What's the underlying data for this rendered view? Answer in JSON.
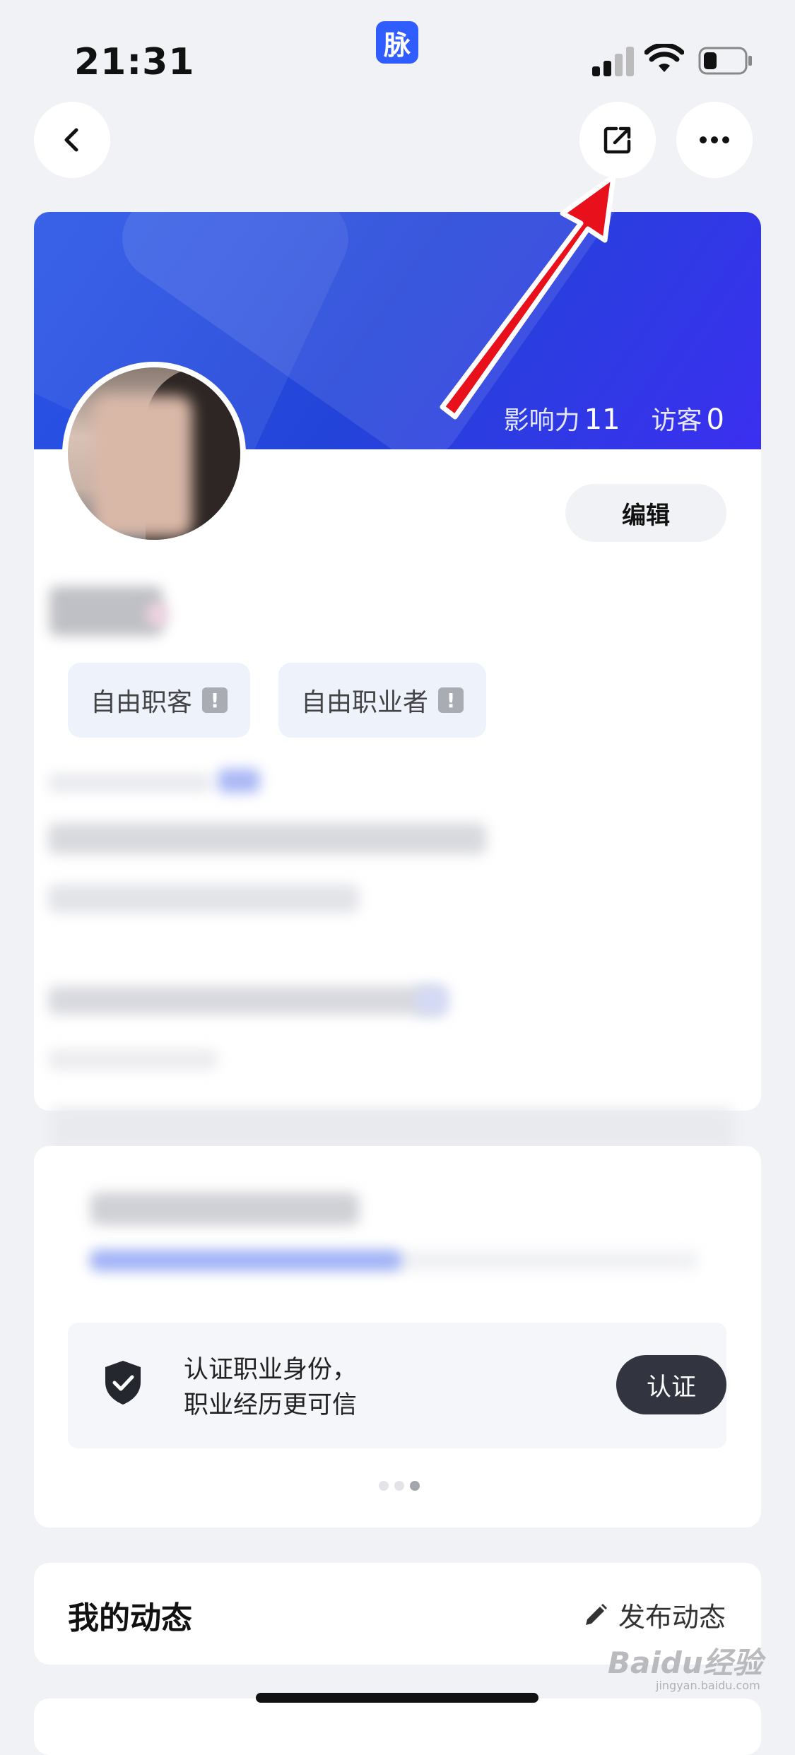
{
  "status_bar": {
    "time": "21:31",
    "app_badge": "脉",
    "accent": "#2f5dff"
  },
  "nav": {
    "back_icon": "chevron-left-icon",
    "share_icon": "share-external-icon",
    "more_icon": "more-horizontal-icon"
  },
  "profile": {
    "stats": [
      {
        "label": "影响力",
        "value": "11"
      },
      {
        "label": "访客",
        "value": "0"
      }
    ],
    "edit_label": "编辑",
    "tags": [
      {
        "label": "自由职客",
        "badge": "!"
      },
      {
        "label": "自由职业者",
        "badge": "!"
      }
    ],
    "banner_colors": [
      "#2a57e8",
      "#3b2ff0"
    ]
  },
  "verify": {
    "line1": "认证职业身份，",
    "line2": "职业经历更可信",
    "button": "认证",
    "page_count": 3,
    "active_page": 3
  },
  "feed": {
    "title": "我的动态",
    "post_label": "发布动态"
  },
  "watermark": {
    "brand": "Baidu经验",
    "url": "jingyan.baidu.com"
  },
  "annotation": {
    "arrow_color": "#e8101a"
  }
}
